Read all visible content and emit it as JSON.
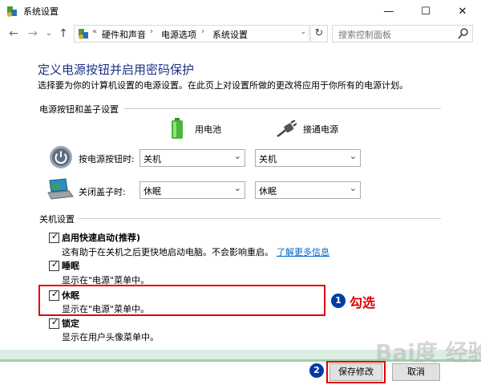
{
  "window": {
    "title": "系统设置",
    "minimize": "—",
    "maximize": "☐",
    "close": "✕"
  },
  "nav": {
    "back": "←",
    "forward": "→",
    "recent": "⌄",
    "up": "↑",
    "crumb_prefix": "«",
    "breadcrumb": [
      "硬件和声音",
      "电源选项",
      "系统设置"
    ],
    "sep": "›",
    "addr_dropdown": "⌄",
    "refresh": "↻",
    "search_placeholder": "搜索控制面板"
  },
  "page": {
    "heading": "定义电源按钮并启用密码保护",
    "description": "选择要为你的计算机设置的电源设置。在此页上对设置所做的更改将应用于你所有的电源计划。"
  },
  "power_section": {
    "label": "电源按钮和盖子设置",
    "columns": [
      "用电池",
      "接通电源"
    ],
    "rows": [
      {
        "label": "按电源按钮时:",
        "battery": "关机",
        "plugged": "关机"
      },
      {
        "label": "关闭盖子时:",
        "battery": "休眠",
        "plugged": "休眠"
      }
    ],
    "caret": "⌄"
  },
  "shutdown_section": {
    "label": "关机设置",
    "items": [
      {
        "label": "启用快速启动(推荐)",
        "checked": true,
        "desc": "这有助于在关机之后更快地启动电脑。不会影响重启。",
        "link": "了解更多信息"
      },
      {
        "label": "睡眠",
        "checked": true,
        "desc": "显示在\"电源\"菜单中。"
      },
      {
        "label": "休眠",
        "checked": true,
        "desc": "显示在\"电源\"菜单中。"
      },
      {
        "label": "锁定",
        "checked": true,
        "desc": "显示在用户头像菜单中。"
      }
    ],
    "check_mark": "✓"
  },
  "annotations": {
    "badge1": "1",
    "text1": "勾选",
    "badge2": "2",
    "watermark": "Bai度 经验",
    "accent": "#e00000",
    "badge_color": "#003ba8"
  },
  "buttons": {
    "save": "保存修改",
    "cancel": "取消"
  }
}
